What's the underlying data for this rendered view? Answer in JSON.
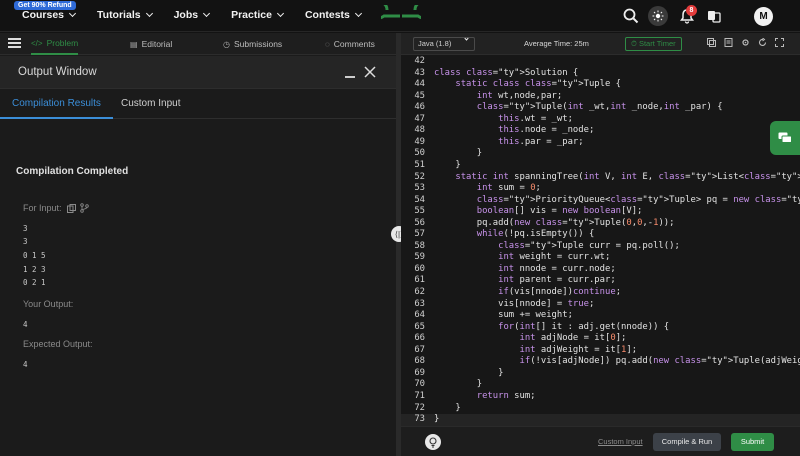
{
  "topnav": {
    "promo": "Get 90% Refund",
    "items": [
      {
        "label": "Courses"
      },
      {
        "label": "Tutorials"
      },
      {
        "label": "Jobs"
      },
      {
        "label": "Practice"
      },
      {
        "label": "Contests"
      }
    ],
    "notification_count": "8",
    "avatar_letter": "M",
    "brand_color": "#2f8d46"
  },
  "problem_tabs": [
    {
      "label": "Problem",
      "icon": "code-icon",
      "active": true
    },
    {
      "label": "Editorial",
      "icon": "book-icon"
    },
    {
      "label": "Submissions",
      "icon": "clock-icon"
    },
    {
      "label": "Comments",
      "icon": "comment-icon"
    }
  ],
  "output": {
    "title": "Output Window",
    "tabs": [
      "Compilation Results",
      "Custom Input"
    ],
    "status": "Compilation Completed",
    "for_input_label": "For Input:",
    "input_lines": [
      "3",
      "3",
      "0 1 5",
      "1 2 3",
      "0 2 1"
    ],
    "your_output_label": "Your Output:",
    "your_output": "4",
    "expected_label": "Expected Output:",
    "expected": "4"
  },
  "editor": {
    "language": "Java (1.8)",
    "average_time": "Average Time: 25m",
    "timer_label": "Start Timer",
    "line_numbers": [
      "42",
      "43",
      "44",
      "45",
      "46",
      "47",
      "48",
      "49",
      "50",
      "51",
      "52",
      "53",
      "54",
      "55",
      "56",
      "57",
      "58",
      "59",
      "60",
      "61",
      "62",
      "63",
      "64",
      "65",
      "66",
      "67",
      "68",
      "69",
      "70",
      "71",
      "72",
      "73"
    ],
    "code": [
      "",
      "class Solution {",
      "    static class Tuple {",
      "        int wt,node,par;",
      "        Tuple(int _wt,int _node,int _par) {",
      "            this.wt = _wt;",
      "            this.node = _node;",
      "            this.par = _par;",
      "        }",
      "    }",
      "    static int spanningTree(int V, int E, List<List<int[]>> adj) {",
      "        int sum = 0;",
      "        PriorityQueue<Tuple> pq = new PriorityQueue<>((a,b) -> a.wt - b",
      "        boolean[] vis = new boolean[V];",
      "        pq.add(new Tuple(0,0,-1));",
      "        while(!pq.isEmpty()) {",
      "            Tuple curr = pq.poll();",
      "            int weight = curr.wt;",
      "            int nnode = curr.node;",
      "            int parent = curr.par;",
      "            if(vis[nnode])continue;",
      "            vis[nnode] = true;",
      "            sum += weight;",
      "            for(int[] it : adj.get(nnode)) {",
      "                int adjNode = it[0];",
      "                int adjWeight = it[1];",
      "                if(!vis[adjNode]) pq.add(new Tuple(adjWeight,adjNode,n",
      "            }",
      "        }",
      "        return sum;",
      "    }",
      "}"
    ],
    "custom_input": "Custom Input",
    "compile_run": "Compile & Run",
    "submit": "Submit"
  }
}
